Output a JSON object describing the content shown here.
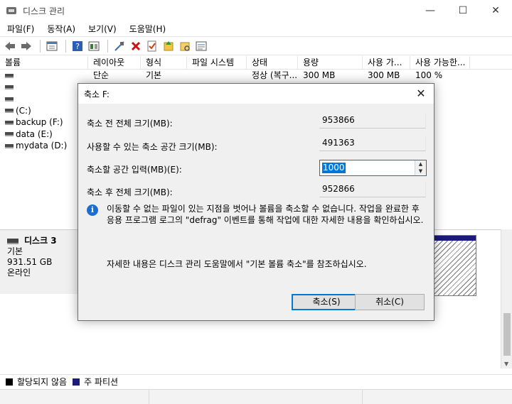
{
  "window": {
    "title": "디스크 관리",
    "minimize_glyph": "—",
    "maximize_glyph": "☐",
    "close_glyph": "✕"
  },
  "menu": [
    "파일(F)",
    "동작(A)",
    "보기(V)",
    "도움말(H)"
  ],
  "toolbar": [
    "back-icon",
    "forward-icon",
    "properties-icon",
    "help-icon",
    "view-icon",
    "connect-icon",
    "delete-icon",
    "check-icon",
    "open-icon",
    "explore-icon",
    "list-icon"
  ],
  "volume_list": {
    "columns": [
      "볼륨",
      "레이아웃",
      "형식",
      "파일 시스템",
      "상태",
      "용량",
      "사용 가...",
      "사용 가능한..."
    ],
    "rows": [
      [
        "",
        "단순",
        "기본",
        "",
        "정상 (복구...",
        "300 MB",
        "300 MB",
        "100 %"
      ],
      [
        "",
        "",
        "",
        "",
        "",
        "",
        "",
        ""
      ],
      [
        "",
        "",
        "",
        "",
        "",
        "",
        "",
        ""
      ],
      [
        "(C:)",
        "",
        "",
        "",
        "",
        "",
        "",
        ""
      ],
      [
        "backup (F:)",
        "",
        "",
        "",
        "",
        "",
        "",
        ""
      ],
      [
        "data (E:)",
        "",
        "",
        "",
        "",
        "",
        "",
        ""
      ],
      [
        "mydata (D:)",
        "",
        "",
        "",
        "",
        "",
        "",
        ""
      ]
    ]
  },
  "disk": {
    "name": "디스크 3",
    "type": "기본",
    "size": "931.51 GB",
    "status": "온라인"
  },
  "legend": [
    {
      "label": "할당되지 않음",
      "color": "#000000"
    },
    {
      "label": "주 파티션",
      "color": "#1b1b7a"
    }
  ],
  "dialog": {
    "title": "축소 F:",
    "close_glyph": "✕",
    "total_before_label": "축소 전 전체 크기(MB):",
    "total_before_value": "953866",
    "available_label": "사용할 수 있는 축소 공간 크기(MB):",
    "available_value": "491363",
    "shrink_label": "축소할 공간 입력(MB)(E):",
    "shrink_value": "1000",
    "total_after_label": "축소 후 전체 크기(MB):",
    "total_after_value": "952866",
    "info_text": "이동할 수 없는 파일이 있는 지점을 벗어나 볼륨을 축소할 수 없습니다. 작업을 완료한 후 응용 프로그램 로그의 \"defrag\" 이벤트를 통해 작업에 대한 자세한 내용을 확인하십시오.",
    "reference_text": "자세한 내용은 디스크 관리 도움말에서 \"기본 볼륨 축소\"를 참조하십시오.",
    "shrink_button": "축소(S)",
    "cancel_button": "취소(C)"
  }
}
